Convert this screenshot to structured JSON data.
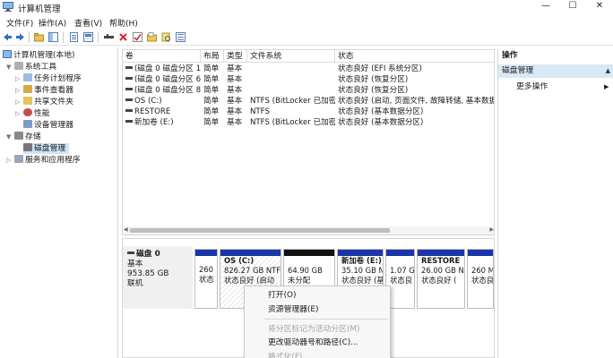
{
  "window": {
    "title": "计算机管理",
    "controls": {
      "minimize": "—",
      "maximize": "☐",
      "close": "✕"
    }
  },
  "menu": [
    "文件(F)",
    "操作(A)",
    "查看(V)",
    "帮助(H)"
  ],
  "toolbar": {
    "icons": [
      "back-icon",
      "forward-icon",
      "up-folder-icon",
      "show-pane-icon",
      "properties-icon",
      "help-icon",
      "connect-icon",
      "delete-icon",
      "checkmark-icon",
      "folder-icon",
      "search-icon",
      "list-view-icon"
    ]
  },
  "tree": {
    "root": "计算机管理(本地)",
    "items": [
      {
        "label": "系统工具",
        "level": 1,
        "expanded": true
      },
      {
        "label": "任务计划程序",
        "level": 2
      },
      {
        "label": "事件查看器",
        "level": 2
      },
      {
        "label": "共享文件夹",
        "level": 2
      },
      {
        "label": "性能",
        "level": 2
      },
      {
        "label": "设备管理器",
        "level": 2
      },
      {
        "label": "存储",
        "level": 1,
        "expanded": true
      },
      {
        "label": "磁盘管理",
        "level": 2,
        "selected": true
      },
      {
        "label": "服务和应用程序",
        "level": 1
      }
    ]
  },
  "volume_list": {
    "columns": [
      "卷",
      "布局",
      "类型",
      "文件系统",
      "状态"
    ],
    "rows": [
      {
        "volume": "(磁盘 0 磁盘分区 1)",
        "layout": "简单",
        "type": "基本",
        "fs": "",
        "status": "状态良好 (EFI 系统分区)"
      },
      {
        "volume": "(磁盘 0 磁盘分区 6)",
        "layout": "简单",
        "type": "基本",
        "fs": "",
        "status": "状态良好 (恢复分区)"
      },
      {
        "volume": "(磁盘 0 磁盘分区 8)",
        "layout": "简单",
        "type": "基本",
        "fs": "",
        "status": "状态良好 (恢复分区)"
      },
      {
        "volume": "OS (C:)",
        "layout": "简单",
        "type": "基本",
        "fs": "NTFS (BitLocker 已加密)",
        "status": "状态良好 (启动, 页面文件, 故障转储, 基本数据分"
      },
      {
        "volume": "RESTORE",
        "layout": "简单",
        "type": "基本",
        "fs": "NTFS",
        "status": "状态良好 (基本数据分区)"
      },
      {
        "volume": "新加卷 (E:)",
        "layout": "简单",
        "type": "基本",
        "fs": "NTFS (BitLocker 已加密)",
        "status": "状态良好 (基本数据分区)"
      }
    ]
  },
  "disk": {
    "name": "磁盘 0",
    "type": "基本",
    "size": "953.85 GB",
    "state": "联机",
    "partitions": [
      {
        "name": "",
        "size": "260",
        "status": "状态",
        "bar": "blue"
      },
      {
        "name": "OS  (C:)",
        "size": "826.27 GB NTFS",
        "status": "状态良好 (启动",
        "bar": "blue",
        "hatched": true
      },
      {
        "name": "",
        "size": "64.90 GB",
        "status": "未分配",
        "bar": "black"
      },
      {
        "name": "新加卷  (E:)",
        "size": "35.10 GB NTFS",
        "status": "状态良好 (基本",
        "bar": "blue"
      },
      {
        "name": "",
        "size": "1.07 G",
        "status": "状态良",
        "bar": "blue"
      },
      {
        "name": "RESTORE",
        "size": "26.00 GB N",
        "status": "状态良好 (",
        "bar": "blue"
      },
      {
        "name": "",
        "size": "260 M",
        "status": "状态良",
        "bar": "blue"
      }
    ]
  },
  "context_menu": {
    "items": [
      {
        "label": "打开(O)",
        "disabled": false
      },
      {
        "label": "资源管理器(E)",
        "disabled": false
      },
      {
        "label": "将分区标记为活动分区(M)",
        "disabled": true
      },
      {
        "label": "更改驱动器号和路径(C)...",
        "disabled": false
      },
      {
        "label": "格式化(F)...",
        "disabled": true
      }
    ]
  },
  "actions": {
    "header": "操作",
    "section": "磁盘管理",
    "more": "更多操作"
  },
  "colors": {
    "partition_bar": "#1b35a9",
    "unallocated_bar": "#111111",
    "selection": "#cce4f7",
    "action_section": "#d9e8f5"
  }
}
